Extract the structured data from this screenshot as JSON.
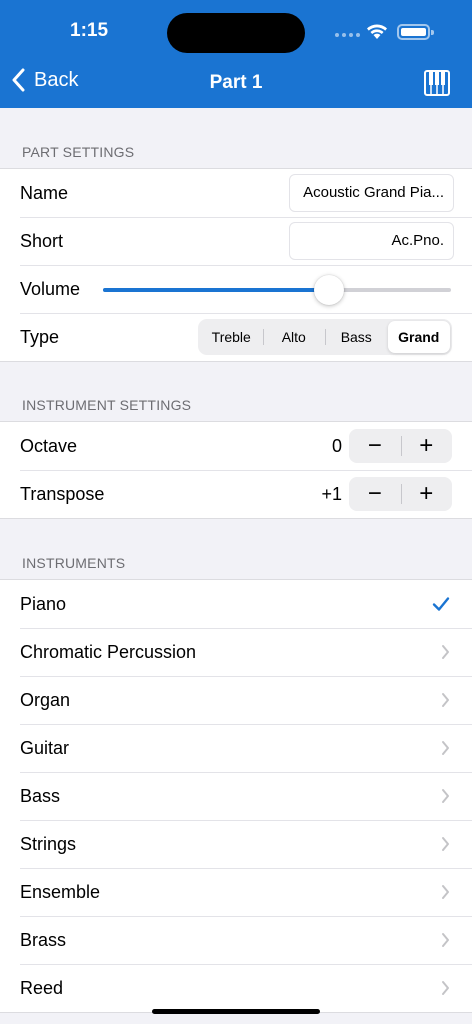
{
  "status_bar": {
    "time": "1:15"
  },
  "nav": {
    "back_label": "Back",
    "title": "Part 1"
  },
  "part_settings": {
    "header": "PART SETTINGS",
    "name_label": "Name",
    "name_value": "Acoustic Grand Pia...",
    "short_label": "Short",
    "short_value": "Ac.Pno.",
    "volume_label": "Volume",
    "volume_level": 0.65,
    "type_label": "Type",
    "type_options": [
      "Treble",
      "Alto",
      "Bass",
      "Grand"
    ],
    "type_selected": "Grand"
  },
  "instrument_settings": {
    "header": "INSTRUMENT SETTINGS",
    "octave_label": "Octave",
    "octave_value": "0",
    "transpose_label": "Transpose",
    "transpose_value": "+1",
    "decrement_symbol": "−",
    "increment_symbol": "+"
  },
  "instruments": {
    "header": "INSTRUMENTS",
    "items": [
      {
        "label": "Piano",
        "accessory": "checkmark-icon"
      },
      {
        "label": "Chromatic Percussion",
        "accessory": "chevron-right-icon"
      },
      {
        "label": "Organ",
        "accessory": "chevron-right-icon"
      },
      {
        "label": "Guitar",
        "accessory": "chevron-right-icon"
      },
      {
        "label": "Bass",
        "accessory": "chevron-right-icon"
      },
      {
        "label": "Strings",
        "accessory": "chevron-right-icon"
      },
      {
        "label": "Ensemble",
        "accessory": "chevron-right-icon"
      },
      {
        "label": "Brass",
        "accessory": "chevron-right-icon"
      },
      {
        "label": "Reed",
        "accessory": "chevron-right-icon"
      }
    ]
  },
  "colors": {
    "accent": "#1a74d2",
    "background": "#f2f2f7",
    "secondary_text": "#6d6d72"
  }
}
